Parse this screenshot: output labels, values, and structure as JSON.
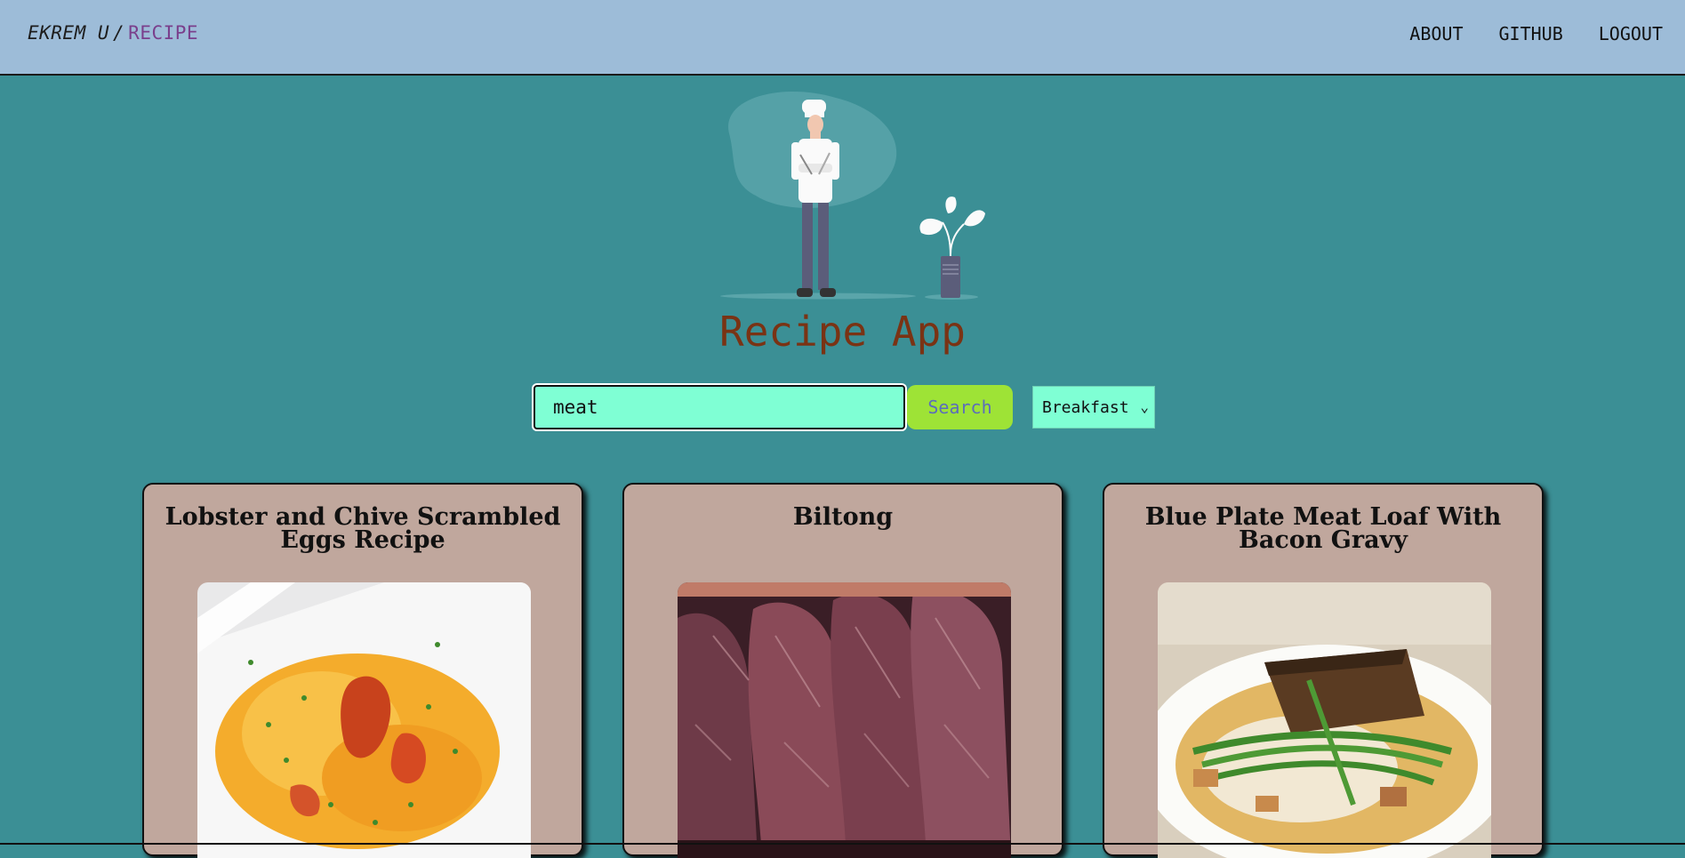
{
  "navbar": {
    "brand_name": "EKREM U",
    "brand_separator": "/",
    "brand_accent": "RECIPE",
    "links": [
      {
        "label": "ABOUT"
      },
      {
        "label": "GITHUB"
      },
      {
        "label": "LOGOUT"
      }
    ]
  },
  "hero": {
    "illustration": "chef-illustration",
    "title": "Recipe App"
  },
  "search": {
    "value": "meat",
    "button_label": "Search",
    "meal_type_selected": "Breakfast"
  },
  "recipes": [
    {
      "title": "Lobster and Chive Scrambled Eggs Recipe",
      "image": "scrambled-eggs-photo"
    },
    {
      "title": "Biltong",
      "image": "biltong-photo"
    },
    {
      "title": "Blue Plate Meat Loaf With Bacon Gravy",
      "image": "meat-loaf-photo"
    }
  ],
  "colors": {
    "background": "#3b8f95",
    "navbar": "#9dbcd8",
    "title": "#7a3314",
    "input": "#7fffd4",
    "button": "#9ee336",
    "card": "#c0a79d"
  }
}
